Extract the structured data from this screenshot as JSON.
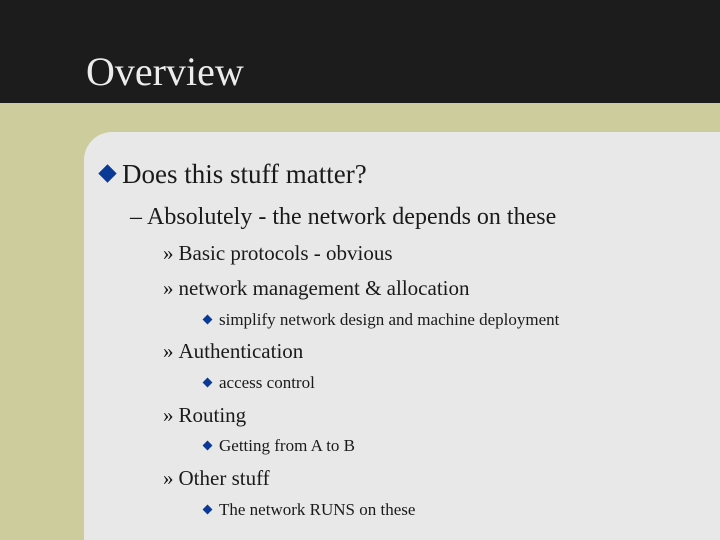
{
  "slide": {
    "title": "Overview",
    "bullets": [
      {
        "level": 1,
        "marker": "diamond",
        "text": "Does this stuff matter?"
      },
      {
        "level": 2,
        "marker": "–",
        "text": "Absolutely - the network depends on these"
      },
      {
        "level": 3,
        "marker": "»",
        "text": "Basic protocols - obvious"
      },
      {
        "level": 3,
        "marker": "»",
        "text": "network management & allocation"
      },
      {
        "level": 4,
        "marker": "diamond",
        "text": "simplify network design and machine deployment"
      },
      {
        "level": 3,
        "marker": "»",
        "text": "Authentication"
      },
      {
        "level": 4,
        "marker": "diamond",
        "text": "access control"
      },
      {
        "level": 3,
        "marker": "»",
        "text": "Routing"
      },
      {
        "level": 4,
        "marker": "diamond",
        "text": "Getting from A to B"
      },
      {
        "level": 3,
        "marker": "»",
        "text": "Other stuff"
      },
      {
        "level": 4,
        "marker": "diamond",
        "text": "The network RUNS on these"
      }
    ]
  },
  "colors": {
    "header_bg": "#1c1c1c",
    "band": "#cccc9c",
    "panel": "#e8e8e8",
    "bullet": "#0a3a96"
  }
}
